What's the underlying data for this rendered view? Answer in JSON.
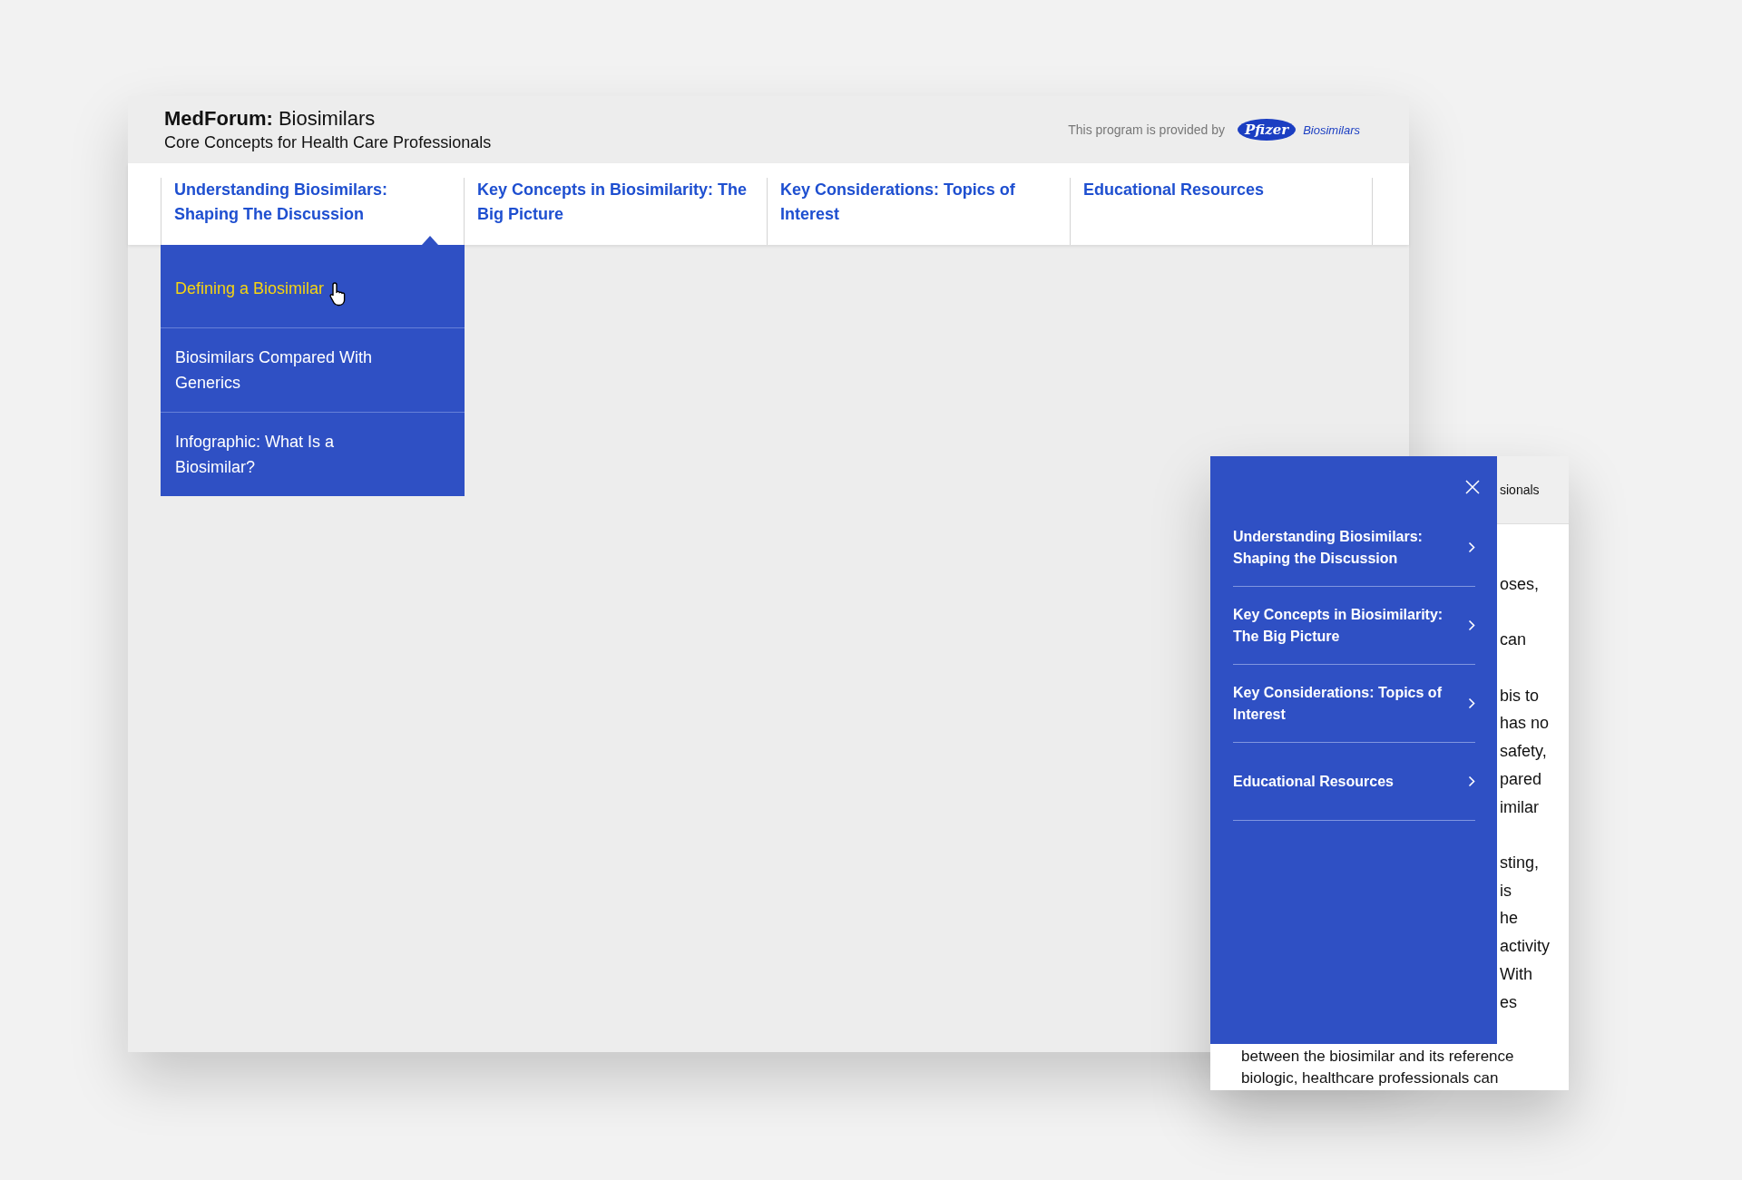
{
  "desktop": {
    "header": {
      "title": "**MedForum:** Biosimilars",
      "subtitle": "Core Concepts for Health Care Professionals",
      "sponsor_text": "This program is provided by",
      "logo_mark": "Pfizer",
      "logo_text": "Biosimilars"
    },
    "nav": [
      {
        "label": "Understanding Biosimilars: Shaping The Discussion",
        "selected": true
      },
      {
        "label": "Key Concepts in Biosimilarity: The Big Picture",
        "selected": false
      },
      {
        "label": "Key Considerations: Topics of Interest",
        "selected": false
      },
      {
        "label": "Educational Resources",
        "selected": false
      }
    ],
    "dropdown": [
      {
        "label": "Defining a Biosimilar",
        "selected": true
      },
      {
        "label": "Biosimilars Compared With Generics",
        "selected": false
      },
      {
        "label": "Infographic: What Is a Biosimilar?",
        "selected": false
      }
    ]
  },
  "mobile": {
    "header_fragment": "sionals",
    "body_paragraphs": [
      [
        "oses,"
      ],
      [
        "can"
      ],
      [
        "bis to",
        "has no",
        "safety,",
        "pared",
        "imilar"
      ],
      [
        "sting,",
        "is",
        "he",
        "activity",
        "With",
        "es"
      ]
    ],
    "bottom_lines": [
      "between the biosimilar and its reference",
      "biologic, healthcare professionals can"
    ],
    "menu": [
      {
        "label": "Understanding Biosimilars: Shaping the Discussion"
      },
      {
        "label": "Key Concepts in Biosimilarity: The Big Picture"
      },
      {
        "label": "Key Considerations: Topics of Interest"
      },
      {
        "label": "Educational Resources"
      }
    ]
  }
}
